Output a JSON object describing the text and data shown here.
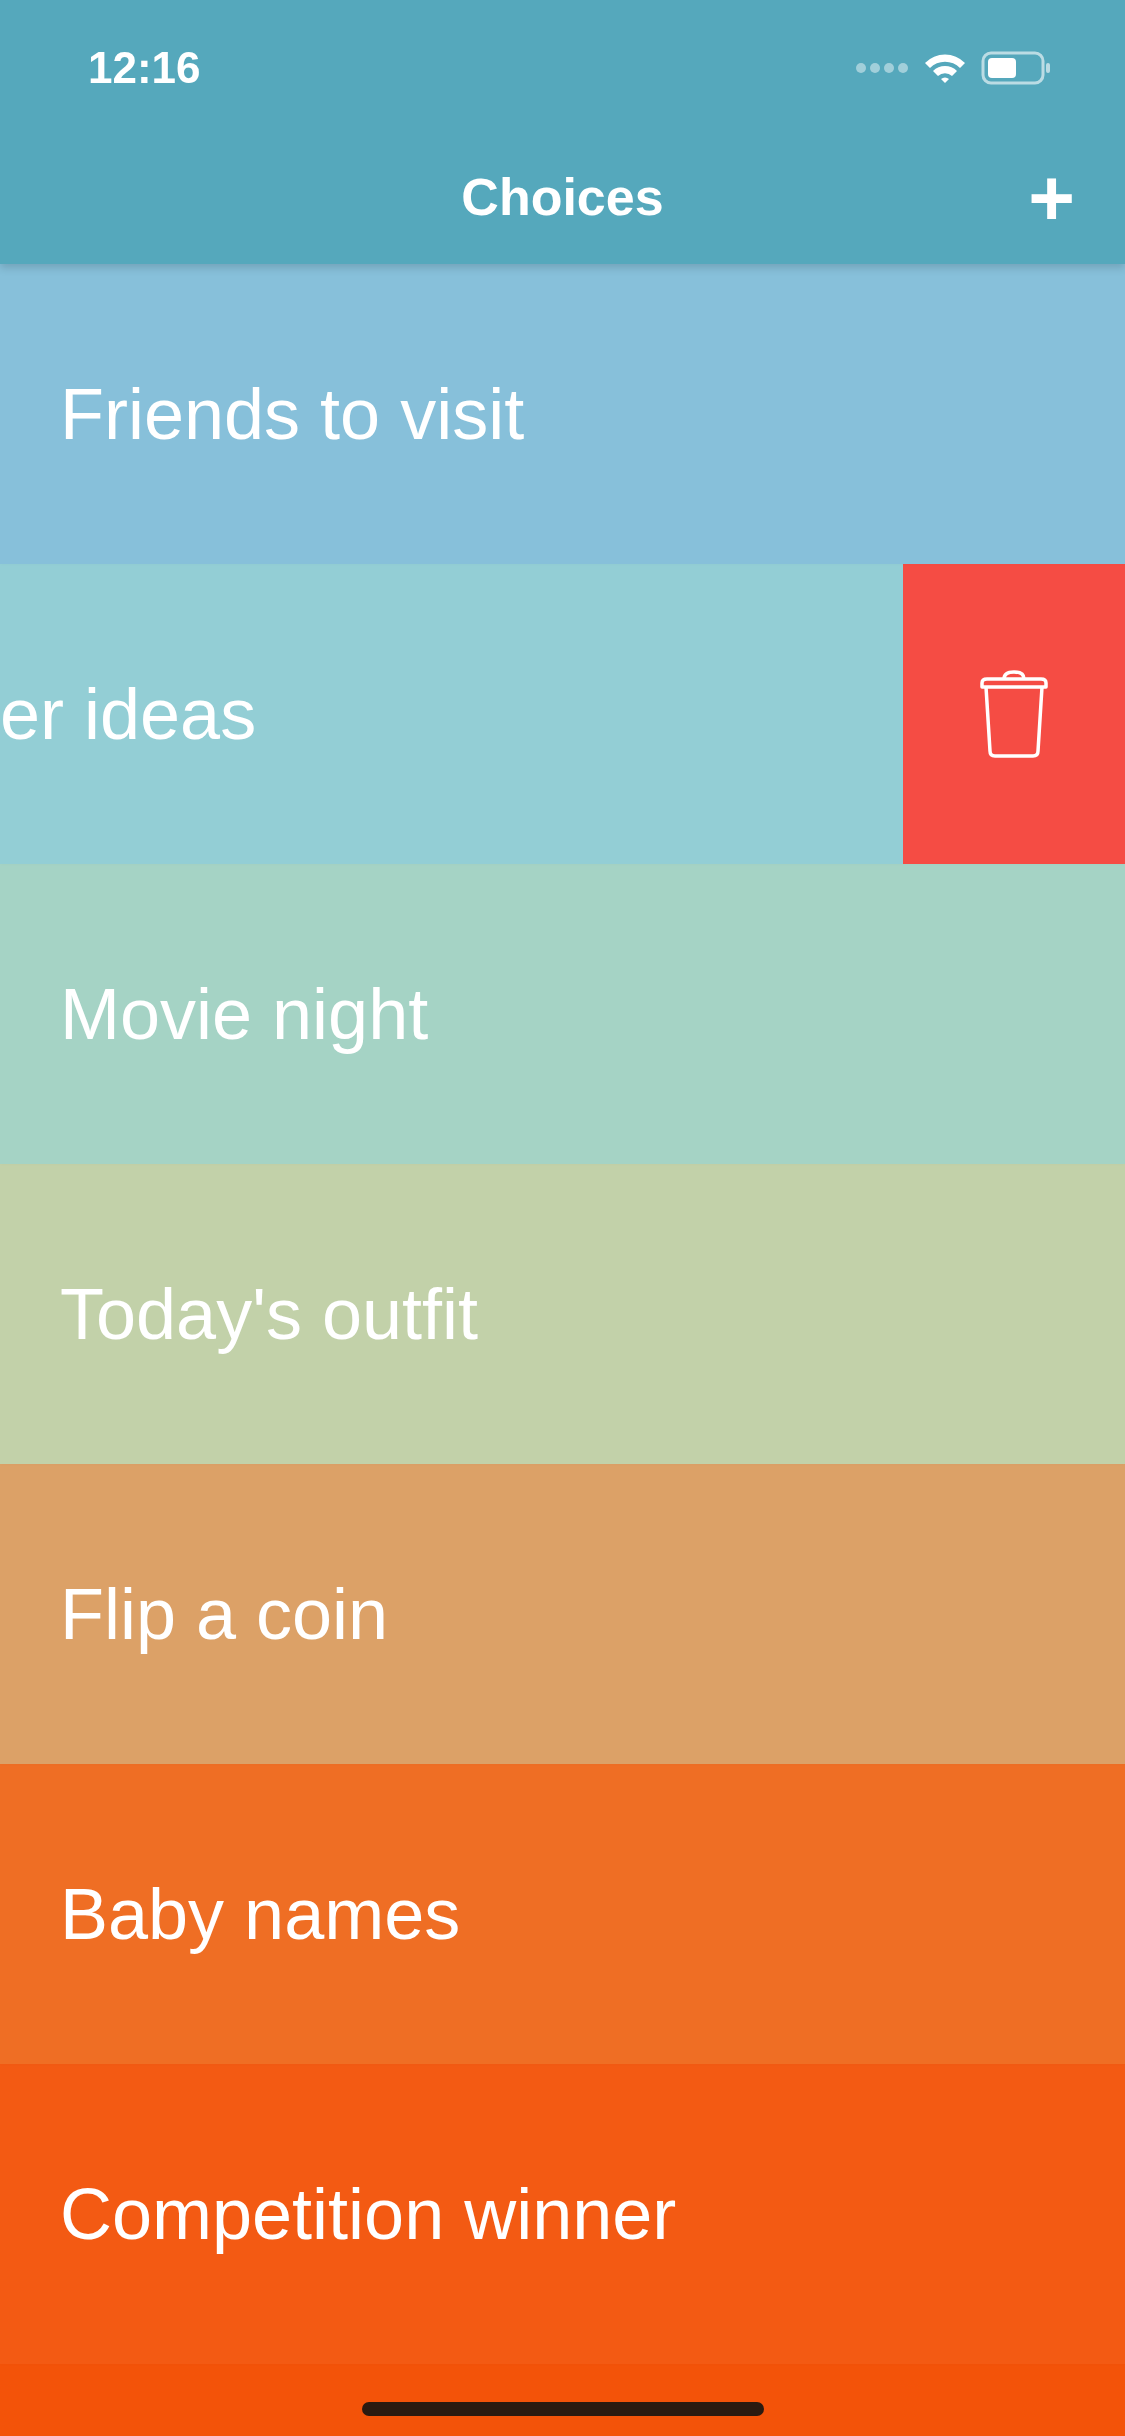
{
  "status_bar": {
    "time": "12:16"
  },
  "nav_bar": {
    "title": "Choices",
    "add_symbol": "+"
  },
  "rows": [
    {
      "label": "Friends to visit",
      "color": "#87c0da",
      "swiped": false
    },
    {
      "label": "er ideas",
      "color": "#93ced5",
      "swiped": true
    },
    {
      "label": "Movie night",
      "color": "#a5d3c5",
      "swiped": false
    },
    {
      "label": "Today's outfit",
      "color": "#c2d1a9",
      "swiped": false
    },
    {
      "label": "Flip a coin",
      "color": "#dca167",
      "swiped": false
    },
    {
      "label": "Baby names",
      "color": "#ef6e24",
      "swiped": false
    },
    {
      "label": "Competition winner",
      "color": "#f35a13",
      "swiped": false
    },
    {
      "color": "#f35309",
      "swiped": false
    }
  ]
}
